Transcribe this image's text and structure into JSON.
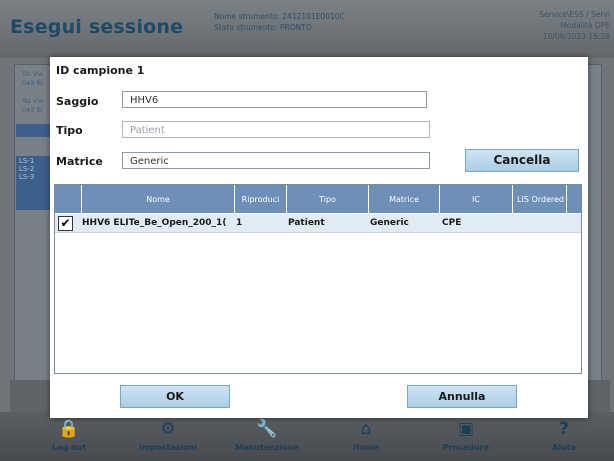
{
  "app": {
    "title": "Esegui sessione",
    "instrument_name": "Nome strumento: 2412101E0010C",
    "instrument_state": "Stato strumento: PRONTO",
    "user": "Service\\ESS / Servi",
    "user_sub": "Modalità OPE",
    "datetime": "10/08/2023 15:28"
  },
  "background_fragments": [
    "Tst Vie",
    "043 Bl",
    "Tst Vie",
    "043 Bl"
  ],
  "background_list": [
    "LS-1",
    "LS-2",
    "LS-3"
  ],
  "dialog": {
    "title": "ID campione 1",
    "assay_label": "Saggio",
    "assay_value": "HHV6",
    "type_label": "Tipo",
    "type_value": "Patient",
    "matrix_label": "Matrice",
    "matrix_value": "Generic",
    "delete_button": "Cancella",
    "ok_button": "OK",
    "cancel_button": "Annulla"
  },
  "table": {
    "columns": [
      "Nome",
      "Riproduci",
      "Tipo",
      "Matrice",
      "IC",
      "LIS Ordered"
    ],
    "rows": [
      {
        "checked": true,
        "nome": "HHV6 ELITe_Be_Open_200_1(",
        "riproduci": "1",
        "tipo": "Patient",
        "matrice": "Generic",
        "ic": "CPE",
        "lis": ""
      }
    ]
  },
  "nav": [
    {
      "label": "Log out",
      "icon": "lock-icon",
      "glyph": "🔒"
    },
    {
      "label": "Impostazioni",
      "icon": "gear-icon",
      "glyph": "⚙"
    },
    {
      "label": "Manutenzione",
      "icon": "wrench-icon",
      "glyph": "🔧"
    },
    {
      "label": "Home",
      "icon": "home-icon",
      "glyph": "⌂"
    },
    {
      "label": "Procedure",
      "icon": "procedures-icon",
      "glyph": "▣"
    },
    {
      "label": "Aiuto",
      "icon": "help-icon",
      "glyph": "?"
    }
  ],
  "colors": {
    "title_blue": "#1d4a66",
    "header_blue": "#6e8fb8",
    "button_blue": "#a9cde6",
    "row_highlight": "#e1ebf6"
  }
}
